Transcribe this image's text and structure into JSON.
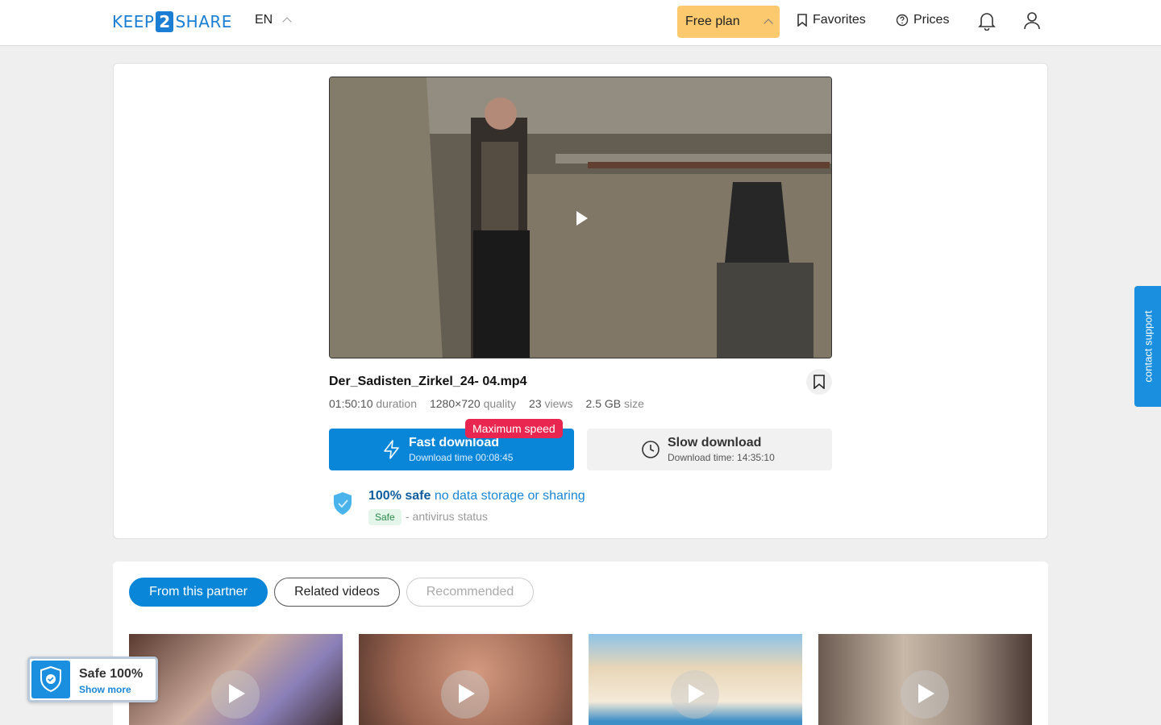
{
  "header": {
    "logo_left": "KEEP",
    "logo_mid": "2",
    "logo_right": "SHARE",
    "lang": "EN",
    "plan": "Free plan",
    "favorites": "Favorites",
    "prices": "Prices"
  },
  "file": {
    "name": "Der_Sadisten_Zirkel_24- 04.mp4",
    "duration": "01:50:10",
    "duration_label": "duration",
    "quality": "1280×720",
    "quality_label": "quality",
    "views": "23",
    "views_label": "views",
    "size": "2.5 GB",
    "size_label": "size"
  },
  "download": {
    "fast_label": "Fast download",
    "fast_time": "Download time 00:08:45",
    "max_badge": "Maximum speed",
    "slow_label": "Slow download",
    "slow_time": "Download time: 14:35:10"
  },
  "safety": {
    "strong": "100% safe",
    "text": "no data storage or sharing",
    "badge": "Safe",
    "status": "- antivirus status"
  },
  "tabs": [
    {
      "label": "From this partner"
    },
    {
      "label": "Related videos"
    },
    {
      "label": "Recommended"
    }
  ],
  "support": "contact support",
  "widget": {
    "title": "Safe 100%",
    "link": "Show more"
  },
  "colors": {
    "accent": "#0a86d9",
    "plan": "#fcc96e",
    "badge_red": "#e8264f",
    "safe_green": "#2a8a4a"
  }
}
